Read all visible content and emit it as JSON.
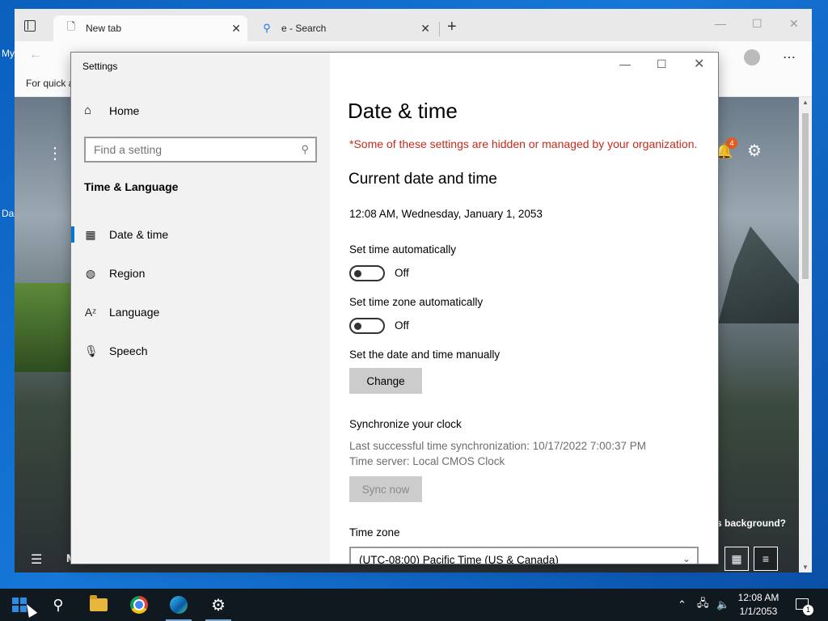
{
  "desktop": {
    "frag_top": "My",
    "frag_mid": "Da"
  },
  "browser": {
    "tabs": [
      {
        "label": "New tab",
        "icon": "page-icon"
      },
      {
        "label": "e - Search",
        "icon": "search-icon"
      }
    ],
    "new_tab_label": "+",
    "favorites_text": "For quick a",
    "notification_count": "4",
    "background_question": "s background?",
    "content_frag": "M"
  },
  "settings": {
    "window_title": "Settings",
    "home_label": "Home",
    "search_placeholder": "Find a setting",
    "section_header": "Time & Language",
    "nav": [
      {
        "label": "Date & time",
        "icon": "calendar-clock-icon",
        "selected": true
      },
      {
        "label": "Region",
        "icon": "globe-icon"
      },
      {
        "label": "Language",
        "icon": "language-icon"
      },
      {
        "label": "Speech",
        "icon": "microphone-icon"
      }
    ],
    "page_title": "Date & time",
    "org_note": "*Some of these settings are hidden or managed by your organization.",
    "current_section": "Current date and time",
    "current_datetime": "12:08 AM, Wednesday, January 1, 2053",
    "set_time_auto_label": "Set time automatically",
    "set_time_auto_state": "Off",
    "set_tz_auto_label": "Set time zone automatically",
    "set_tz_auto_state": "Off",
    "manual_label": "Set the date and time manually",
    "change_button": "Change",
    "sync_title": "Synchronize your clock",
    "last_sync": "Last successful time synchronization: 10/17/2022 7:00:37 PM",
    "time_server": "Time server: Local CMOS Clock",
    "sync_button": "Sync now",
    "timezone_label": "Time zone",
    "timezone_value": "(UTC-08:00) Pacific Time (US & Canada)"
  },
  "taskbar": {
    "time": "12:08 AM",
    "date": "1/1/2053",
    "notification_count": "1"
  },
  "colors": {
    "accent": "#0078d7",
    "warning": "#c42b1c"
  }
}
